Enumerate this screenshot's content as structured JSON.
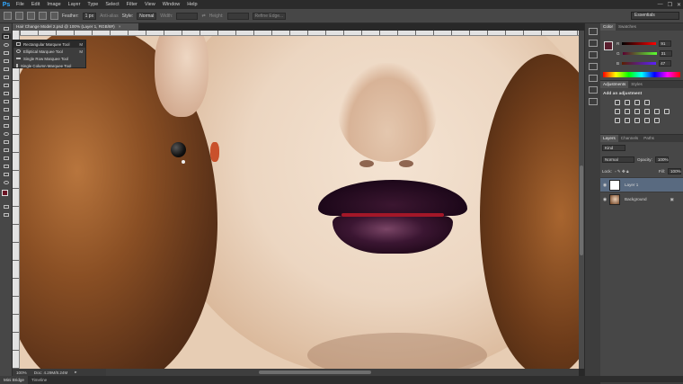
{
  "app": {
    "logo": "Ps"
  },
  "menu": [
    "File",
    "Edit",
    "Image",
    "Layer",
    "Type",
    "Select",
    "Filter",
    "View",
    "Window",
    "Help"
  ],
  "window_controls": {
    "minimize": "—",
    "restore": "❐",
    "close": "✕"
  },
  "options": {
    "feather_label": "Feather:",
    "feather_value": "1 px",
    "anti_alias": "Anti-alias",
    "style_label": "Style:",
    "style_value": "Normal",
    "width_label": "Width:",
    "height_label": "Height:",
    "refine_edge": "Refine Edge...",
    "workspace": "Essentials"
  },
  "document": {
    "tab_title": "Hair Change Model 2.psd @ 100% (Layer 1, RGB/8#)",
    "close": "×"
  },
  "flyout": {
    "items": [
      {
        "label": "Rectangular Marquee Tool",
        "key": "M"
      },
      {
        "label": "Elliptical Marquee Tool",
        "key": "M"
      },
      {
        "label": "Single Row Marquee Tool",
        "key": ""
      },
      {
        "label": "Single Column Marquee Tool",
        "key": ""
      }
    ]
  },
  "status": {
    "zoom": "100%",
    "doc": "Doc: 4.29M/8.24M"
  },
  "bottom_tabs": [
    "Mini Bridge",
    "Timeline"
  ],
  "color_panel": {
    "tabs": [
      "Color",
      "Swatches"
    ],
    "channels": [
      {
        "label": "R",
        "value": "91",
        "color": "#d24a4a"
      },
      {
        "label": "G",
        "value": "31",
        "color": "#3fa64a"
      },
      {
        "label": "B",
        "value": "47",
        "color": "#3a62c9"
      }
    ],
    "foreground": "#5b1f2f"
  },
  "adjustments": {
    "tabs": [
      "Adjustments",
      "Styles"
    ],
    "title": "Add an adjustment"
  },
  "layers": {
    "tabs": [
      "Layers",
      "Channels",
      "Paths"
    ],
    "kind_label": "Kind",
    "blend_mode": "Normal",
    "opacity_label": "Opacity:",
    "opacity_value": "100%",
    "lock_label": "Lock:",
    "fill_label": "Fill:",
    "fill_value": "100%",
    "items": [
      {
        "name": "Layer 1"
      },
      {
        "name": "Background"
      }
    ]
  }
}
